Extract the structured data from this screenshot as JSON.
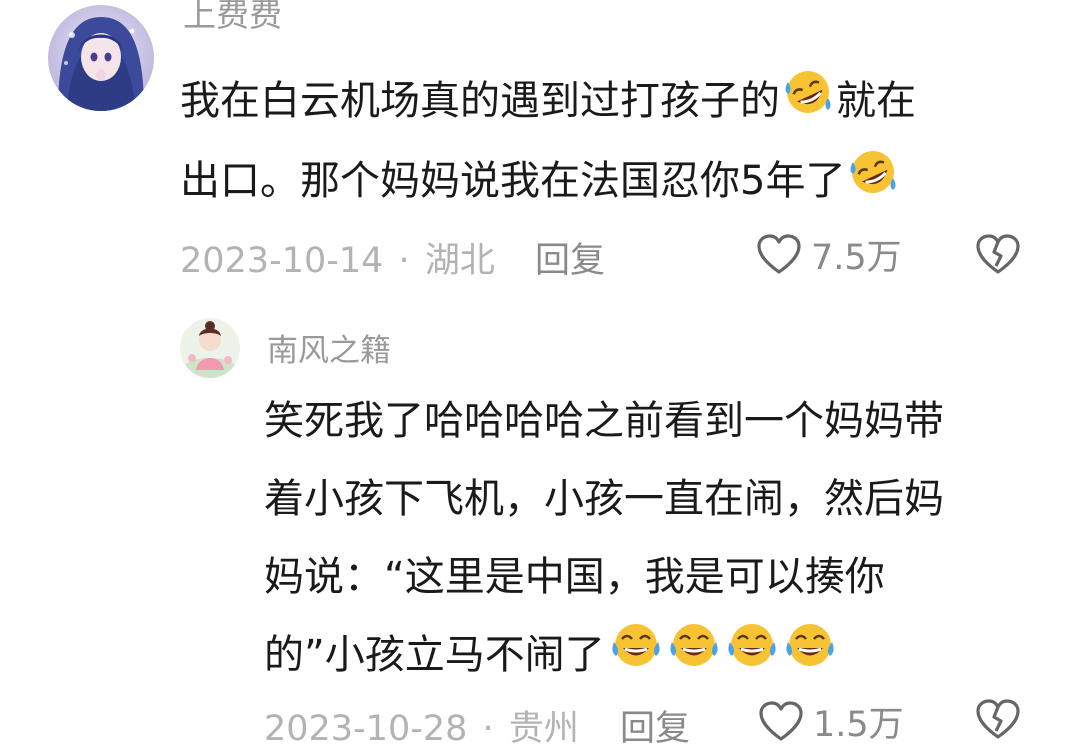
{
  "comments": [
    {
      "username": "上费费",
      "lines": [
        "我在白云机场真的遇到过打孩子的",
        "就在",
        "出口。那个妈妈说我在法国忍你5年了"
      ],
      "date": "2023-10-14",
      "location": "湖北",
      "reply_label": "回复",
      "likes": "7.5万",
      "emoji": "rofl-emoji"
    },
    {
      "username": "南风之籍",
      "lines": [
        "笑死我了哈哈哈哈之前看到一个妈妈带",
        "着小孩下飞机，小孩一直在闹，然后妈",
        "妈说：“这里是中国，我是可以揍你",
        "的”小孩立马不闹了"
      ],
      "date": "2023-10-28",
      "location": "贵州",
      "reply_label": "回复",
      "likes": "1.5万",
      "emoji": "tears-of-joy-emoji"
    }
  ],
  "separator": "·",
  "icons": {
    "like": "heart-outline-icon",
    "dislike": "broken-heart-icon"
  },
  "colors": {
    "text": "#1a1a1a",
    "meta": "#b3b3b3",
    "action": "#8a8a8a",
    "emoji_face": "#f7c333"
  }
}
